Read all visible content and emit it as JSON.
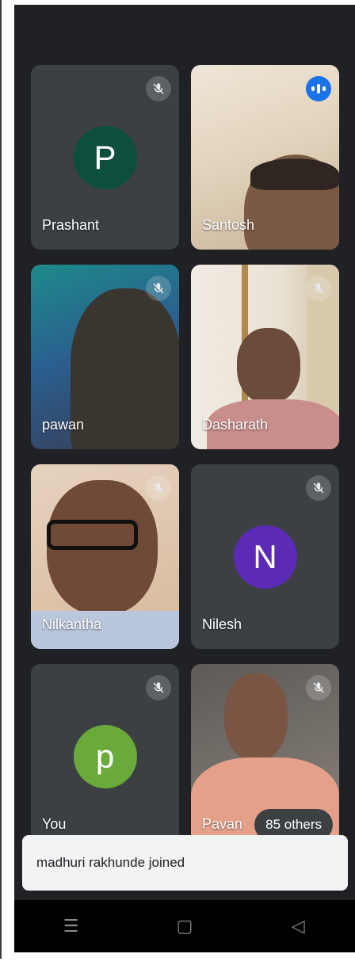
{
  "participants": [
    {
      "name": "Prashant",
      "initial": "P",
      "avatar_color": "#0d4f3d",
      "muted": true
    },
    {
      "name": "Santosh",
      "speaking": true
    },
    {
      "name": "pawan",
      "muted": true
    },
    {
      "name": "Dasharath",
      "muted": true
    },
    {
      "name": "Nilkantha",
      "muted": true
    },
    {
      "name": "Nilesh",
      "initial": "N",
      "avatar_color": "#5b2bb5",
      "muted": true
    },
    {
      "name": "You",
      "initial": "p",
      "avatar_color": "#6aaa3a",
      "muted": true
    },
    {
      "name": "Pavan",
      "muted": true
    }
  ],
  "others_label": "85 others",
  "toast": {
    "message": "madhuri rakhunde joined"
  },
  "navbar": {
    "icons": [
      "menu-icon",
      "home-icon",
      "back-icon"
    ]
  }
}
